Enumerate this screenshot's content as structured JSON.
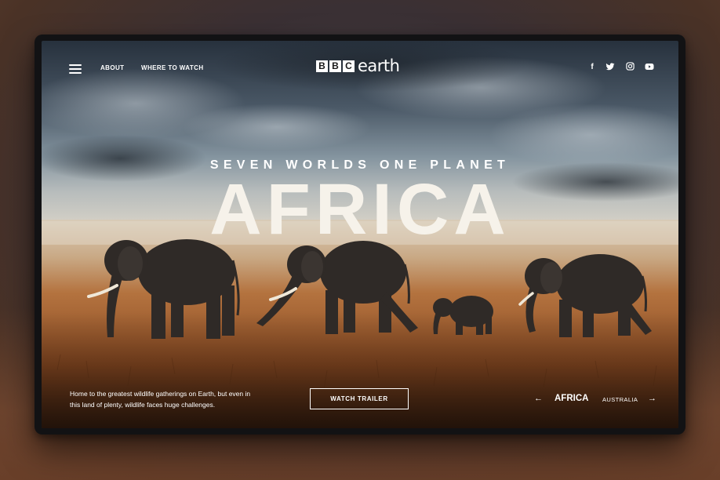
{
  "nav": {
    "about": "ABOUT",
    "where_to_watch": "WHERE TO WATCH"
  },
  "logo": {
    "letters": [
      "B",
      "B",
      "C"
    ],
    "word": "earth"
  },
  "social": {
    "facebook": "f",
    "twitter": "twitter-icon",
    "instagram": "instagram-icon",
    "youtube": "youtube-icon"
  },
  "hero": {
    "subtitle": "SEVEN WORLDS ONE PLANET",
    "title": "AFRICA",
    "tagline": "Home to the greatest wildlife gatherings on Earth, but even in this land of plenty, wildlife faces huge challenges.",
    "cta": "WATCH TRAILER"
  },
  "slider": {
    "prev": "←",
    "next": "→",
    "current": "AFRICA",
    "upcoming": "AUSTRALIA"
  },
  "colors": {
    "sky_top": "#2f3946",
    "sky_haze": "#a7b2b8",
    "savanna": "#a8622e",
    "text": "#ffffff"
  }
}
